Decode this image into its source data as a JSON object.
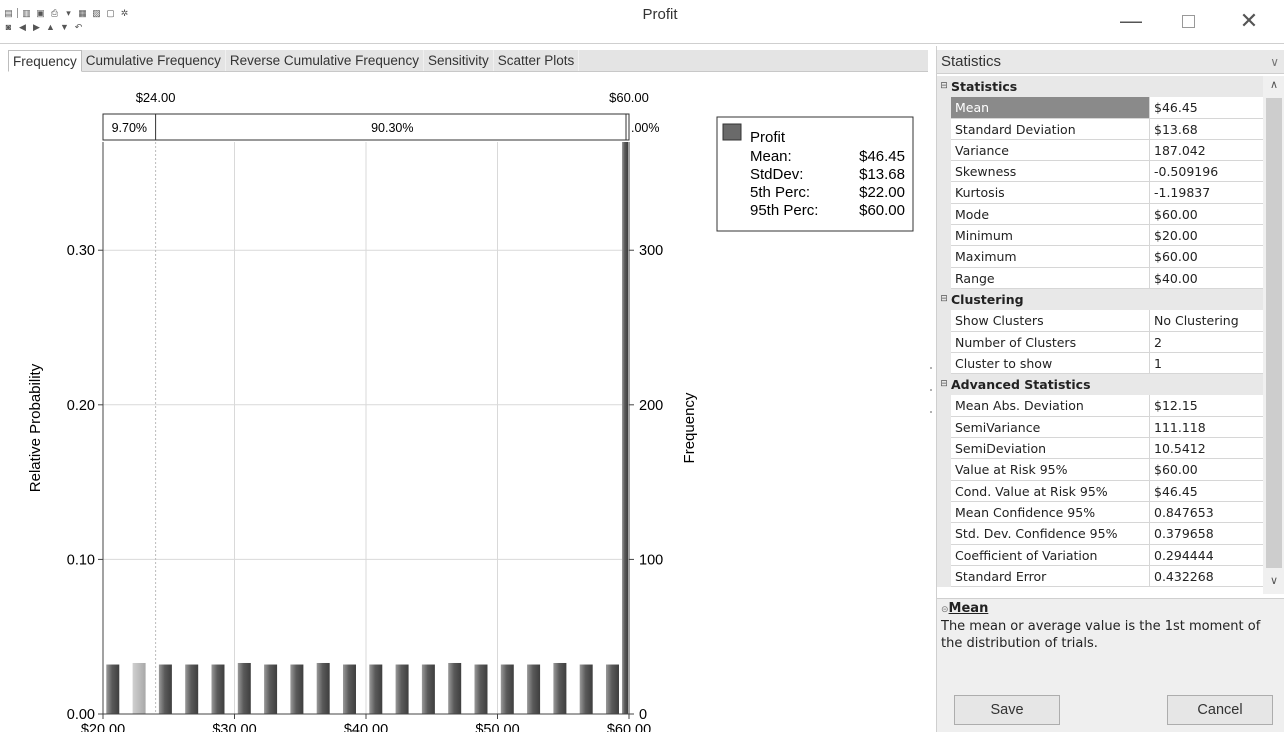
{
  "window": {
    "title": "Profit",
    "minimize_glyph": "—",
    "close_glyph": "✕"
  },
  "toolbar": {
    "row1": [
      "doc-icon",
      "copy-icon",
      "save-icon",
      "print-icon",
      "dropdown-icon",
      "grid-icon",
      "chart-icon",
      "window-icon",
      "settings-icon"
    ],
    "row2": [
      "camera-icon",
      "left-icon",
      "right-icon",
      "up-icon",
      "down-icon",
      "undo-icon"
    ]
  },
  "tabs": [
    {
      "label": "Frequency",
      "active": true
    },
    {
      "label": "Cumulative Frequency",
      "active": false
    },
    {
      "label": "Reverse Cumulative Frequency",
      "active": false
    },
    {
      "label": "Sensitivity",
      "active": false
    },
    {
      "label": "Scatter Plots",
      "active": false
    }
  ],
  "chart_data": {
    "type": "bar",
    "xlabel": "",
    "ylabel": "Relative Probability",
    "y2label": "Frequency",
    "xlim": [
      20,
      60
    ],
    "ylim": [
      0,
      0.37
    ],
    "y2lim": [
      0,
      370
    ],
    "xticks": [
      "$20.00",
      "$30.00",
      "$40.00",
      "$50.00",
      "$60.00"
    ],
    "xtick_values": [
      20,
      30,
      40,
      50,
      60
    ],
    "yticks": [
      "0.00",
      "0.10",
      "0.20",
      "0.30"
    ],
    "ytick_values": [
      0,
      0.1,
      0.2,
      0.3
    ],
    "y2ticks": [
      "0",
      "100",
      "200",
      "300"
    ],
    "y2tick_values": [
      0,
      100,
      200,
      300
    ],
    "grid": true,
    "bin_centers": [
      20.25,
      22.25,
      24.25,
      26.25,
      28.25,
      30.25,
      32.25,
      34.25,
      36.25,
      38.25,
      40.25,
      42.25,
      44.25,
      46.25,
      48.25,
      50.25,
      52.25,
      54.25,
      56.25,
      58.25,
      59.9
    ],
    "values": [
      0.032,
      0.033,
      0.032,
      0.032,
      0.032,
      0.033,
      0.032,
      0.032,
      0.033,
      0.032,
      0.032,
      0.032,
      0.032,
      0.033,
      0.032,
      0.032,
      0.032,
      0.033,
      0.032,
      0.032,
      0.37
    ],
    "highlight": [
      false,
      true,
      false,
      false,
      false,
      false,
      false,
      false,
      false,
      false,
      false,
      false,
      false,
      false,
      false,
      false,
      false,
      false,
      false,
      false,
      false
    ],
    "percentile_bar": {
      "left_label": "$24.00",
      "right_label": "$60.00",
      "left_value": 24,
      "right_value": 60,
      "segments": [
        "9.70%",
        "90.30%",
        ".00%"
      ]
    },
    "legend": {
      "series": "Profit",
      "position": "top-right",
      "rows": [
        {
          "label": "Mean:",
          "value": "$46.45"
        },
        {
          "label": "StdDev:",
          "value": "$13.68"
        },
        {
          "label": "5th Perc:",
          "value": "$22.00"
        },
        {
          "label": "95th Perc:",
          "value": "$60.00"
        }
      ]
    },
    "colors": {
      "bar": "#5a5a5a",
      "highlight": "#a8a8a8",
      "grid": "#d9d9d9"
    }
  },
  "stats_panel": {
    "header": "Statistics",
    "rows": [
      {
        "type": "cat",
        "name": "Statistics"
      },
      {
        "name": "Mean",
        "value": "$46.45",
        "selected": true
      },
      {
        "name": "Standard Deviation",
        "value": "$13.68"
      },
      {
        "name": "Variance",
        "value": "187.042"
      },
      {
        "name": "Skewness",
        "value": "-0.509196"
      },
      {
        "name": "Kurtosis",
        "value": "-1.19837"
      },
      {
        "name": "Mode",
        "value": "$60.00"
      },
      {
        "name": "Minimum",
        "value": "$20.00"
      },
      {
        "name": "Maximum",
        "value": "$60.00"
      },
      {
        "name": "Range",
        "value": "$40.00"
      },
      {
        "type": "cat",
        "name": "Clustering"
      },
      {
        "name": "Show Clusters",
        "value": "No Clustering"
      },
      {
        "name": "Number of Clusters",
        "value": "2"
      },
      {
        "name": "Cluster to show",
        "value": "1"
      },
      {
        "type": "cat",
        "name": "Advanced Statistics"
      },
      {
        "name": "Mean Abs. Deviation",
        "value": "$12.15"
      },
      {
        "name": "SemiVariance",
        "value": "111.118"
      },
      {
        "name": "SemiDeviation",
        "value": "10.5412"
      },
      {
        "name": "Value at Risk 95%",
        "value": "$60.00"
      },
      {
        "name": "Cond. Value at Risk 95%",
        "value": "$46.45"
      },
      {
        "name": "Mean Confidence 95%",
        "value": "0.847653"
      },
      {
        "name": "Std. Dev. Confidence 95%",
        "value": "0.379658"
      },
      {
        "name": "Coefficient of Variation",
        "value": "0.294444"
      },
      {
        "name": "Standard Error",
        "value": "0.432268"
      }
    ],
    "description": {
      "title": "Mean",
      "text": "The mean or average value is the 1st moment of the distribution of trials."
    },
    "buttons": {
      "save": "Save",
      "cancel": "Cancel"
    }
  }
}
